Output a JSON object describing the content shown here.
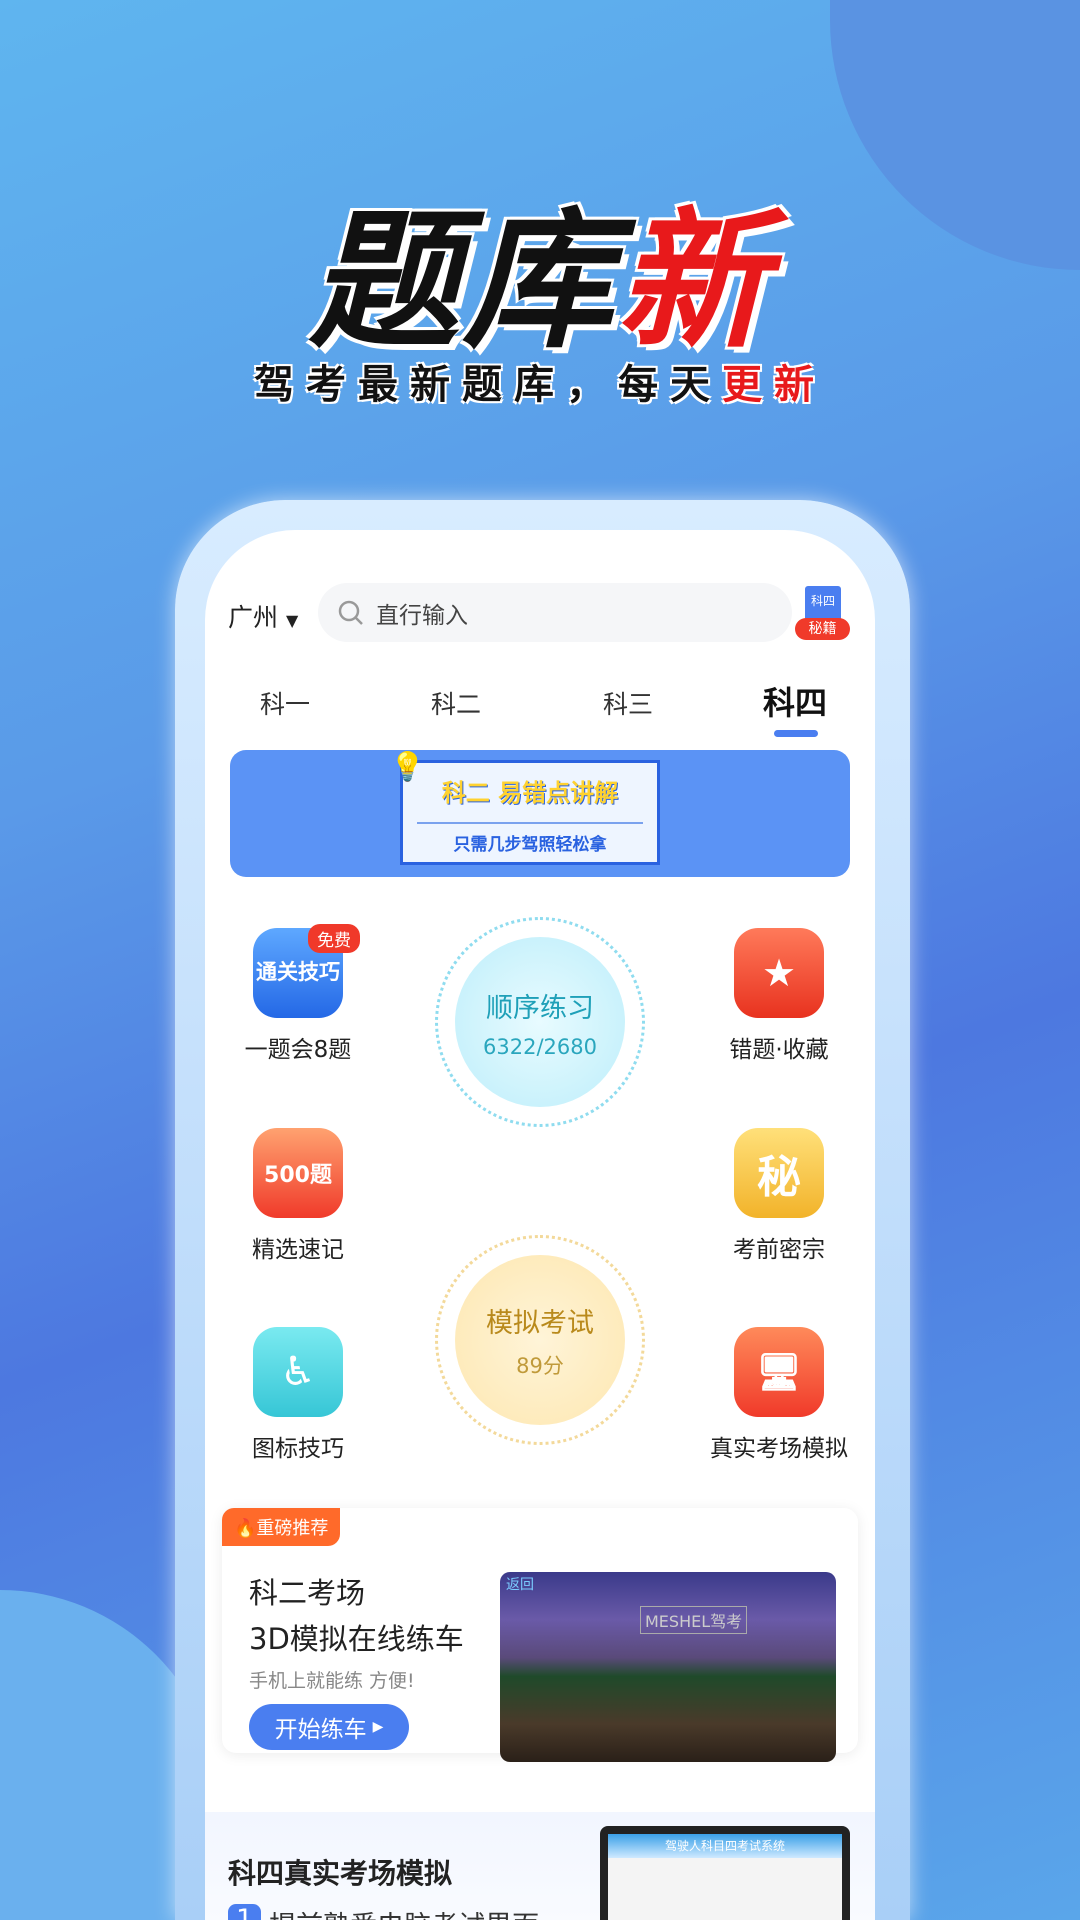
{
  "hero": {
    "title_main": "题库",
    "title_accent": "新",
    "subtitle_main": "驾考最新题库，每天",
    "subtitle_accent": "更新"
  },
  "header": {
    "city": "广州",
    "search_placeholder": "直行输入",
    "book_badge_top": "科四",
    "book_badge_bottom": "秘籍"
  },
  "tabs": [
    {
      "label": "科一"
    },
    {
      "label": "科二"
    },
    {
      "label": "科三"
    },
    {
      "label": "科四",
      "active": true
    }
  ],
  "banner": {
    "title": "科二 易错点讲解",
    "subtitle": "只需几步驾照轻松拿"
  },
  "grid": {
    "tips": {
      "icon_text": "通关技巧",
      "badge": "免费",
      "label": "一题会8题"
    },
    "wrong": {
      "label": "错题·收藏"
    },
    "quick": {
      "icon_text": "500题",
      "label": "精选速记"
    },
    "secret": {
      "icon_text": "秘",
      "label": "考前密宗"
    },
    "signs": {
      "label": "图标技巧"
    },
    "real": {
      "label": "真实考场模拟"
    },
    "sequence": {
      "title": "顺序练习",
      "progress": "6322/2680"
    },
    "exam": {
      "title": "模拟考试",
      "score": "89分",
      "score_fraction": 0.15
    }
  },
  "promo": {
    "badge": "重磅推荐",
    "title1": "科二考场",
    "title2": "3D模拟在线练车",
    "desc": "手机上就能练 方便!",
    "button": "开始练车",
    "image_sign": "MESHEL驾考",
    "image_back": "返回"
  },
  "section2": {
    "title": "科四真实考场模拟",
    "bullet_num": "1",
    "bullet_text": "提前熟悉电脑考试界面",
    "monitor_title": "驾驶人科目四考试系统"
  },
  "colors": {
    "accent": "#4a7ef0",
    "red": "#e8191b",
    "orange": "#ff6a2a"
  }
}
